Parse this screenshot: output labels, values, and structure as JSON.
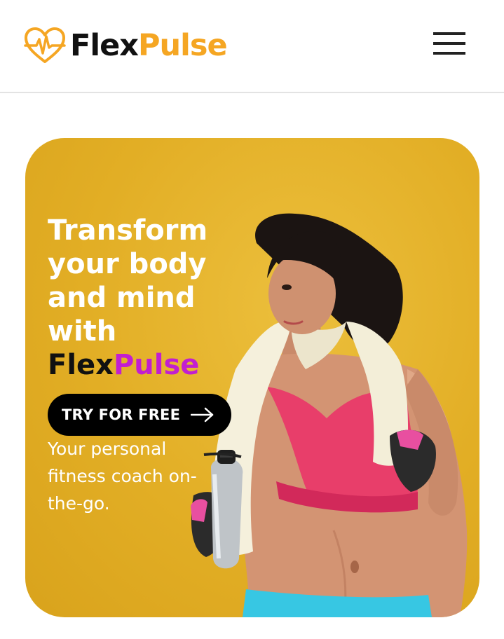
{
  "header": {
    "logo": {
      "icon": "heart-pulse-icon",
      "brand_part1": "Flex",
      "brand_part2": "Pulse",
      "colors": {
        "part1": "#111111",
        "part2": "#f5a623"
      }
    },
    "menu_icon": "hamburger-menu-icon"
  },
  "hero": {
    "headline_lines": [
      "Transform",
      "your body",
      "and mind",
      "with"
    ],
    "brand_part1": "Flex",
    "brand_part2": "Pulse",
    "brand_colors": {
      "part1": "#111111",
      "part2": "#c21fd0"
    },
    "cta": {
      "label": "TRY FOR FREE",
      "icon": "arrow-right-icon"
    },
    "subtitle": "Your personal fitness coach on-the-go.",
    "background_color": "#e2ae25"
  }
}
